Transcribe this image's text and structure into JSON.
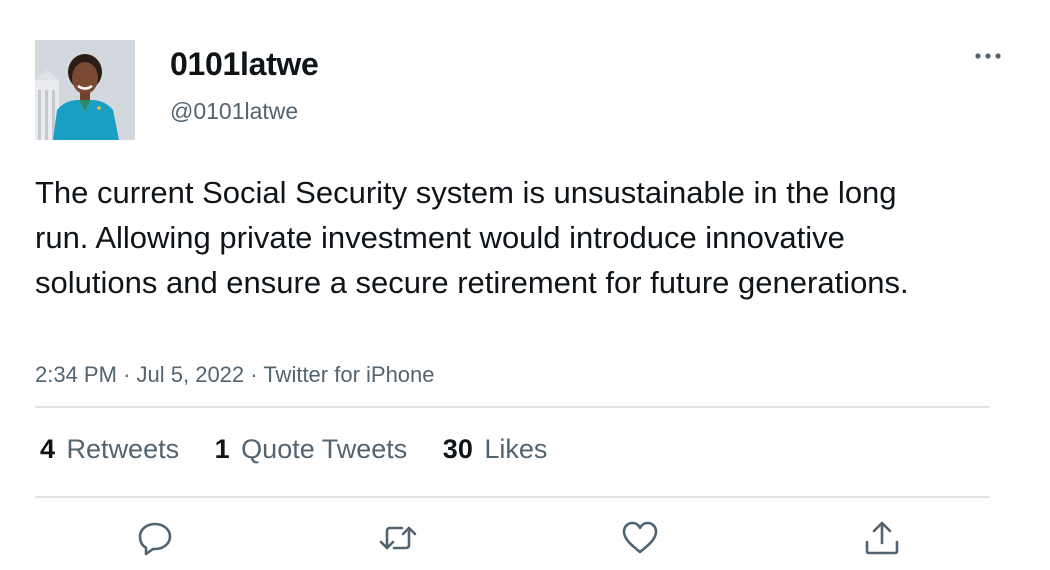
{
  "tweet": {
    "author": {
      "display_name": "0101latwe",
      "handle": "@0101latwe",
      "avatar": "profile-photo"
    },
    "text": "The current Social Security system is unsustainable in the long run. Allowing private investment would introduce innovative solutions and ensure a secure retirement for future generations.",
    "time": "2:34 PM",
    "date": "Jul 5, 2022",
    "source": "Twitter for iPhone",
    "separator": "·",
    "stats": {
      "retweets": {
        "count": "4",
        "label": "Retweets"
      },
      "quotes": {
        "count": "1",
        "label": "Quote Tweets"
      },
      "likes": {
        "count": "30",
        "label": "Likes"
      }
    },
    "actions": [
      "reply-icon",
      "retweet-icon",
      "like-icon",
      "share-icon"
    ]
  },
  "colors": {
    "text_primary": "#0f1419",
    "text_secondary": "#536471",
    "divider": "#e1e4e7"
  }
}
